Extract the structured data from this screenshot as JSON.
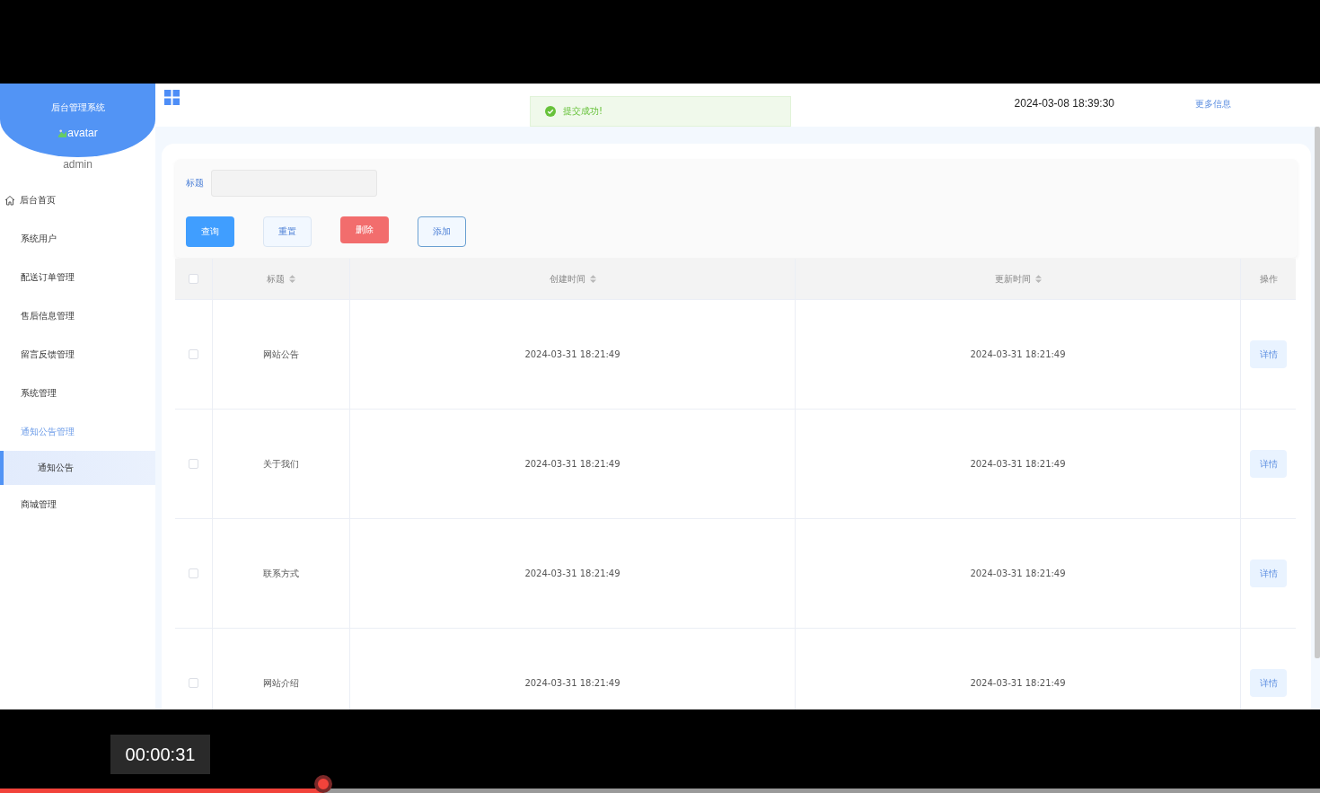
{
  "header": {
    "title": "后台管理系统",
    "avatar_alt": "avatar",
    "user": "admin",
    "datetime": "2024-03-08 18:39:30",
    "more_link": "更多信息"
  },
  "toast": {
    "kind": "success",
    "message": "提交成功!"
  },
  "sidebar": {
    "items": [
      {
        "kind": "home",
        "label": "后台首页",
        "selected": false,
        "expanded": false
      },
      {
        "kind": "group",
        "label": "系统用户",
        "selected": false,
        "expanded": false
      },
      {
        "kind": "group",
        "label": "配送订单管理",
        "selected": false,
        "expanded": false
      },
      {
        "kind": "group",
        "label": "售后信息管理",
        "selected": false,
        "expanded": false
      },
      {
        "kind": "group",
        "label": "留言反馈管理",
        "selected": false,
        "expanded": false
      },
      {
        "kind": "group",
        "label": "系统管理",
        "selected": false,
        "expanded": false
      },
      {
        "kind": "group",
        "label": "通知公告管理",
        "selected": false,
        "expanded": true,
        "children": [
          {
            "label": "通知公告",
            "selected": true
          }
        ]
      },
      {
        "kind": "group",
        "label": "商城管理",
        "selected": false,
        "expanded": false
      }
    ]
  },
  "search": {
    "label": "标题"
  },
  "buttons": [
    {
      "kind": "primary",
      "label": "查询"
    },
    {
      "kind": "plain",
      "label": "重置"
    },
    {
      "kind": "danger",
      "label": "删除"
    },
    {
      "kind": "hover",
      "label": "添加"
    }
  ],
  "table": {
    "header_checked": false,
    "columns": [
      {
        "label": "标题",
        "sortable": true
      },
      {
        "label": "创建时间",
        "sortable": true
      },
      {
        "label": "更新时间",
        "sortable": true
      },
      {
        "label": "操作",
        "sortable": false
      }
    ],
    "rows": [
      {
        "checked": false,
        "title": "网站公告",
        "created": "2024-03-31 18:21:49",
        "updated": "2024-03-31 18:21:49",
        "action": "详情"
      },
      {
        "checked": false,
        "title": "关于我们",
        "created": "2024-03-31 18:21:49",
        "updated": "2024-03-31 18:21:49",
        "action": "详情"
      },
      {
        "checked": false,
        "title": "联系方式",
        "created": "2024-03-31 18:21:49",
        "updated": "2024-03-31 18:21:49",
        "action": "详情"
      },
      {
        "checked": false,
        "title": "网站介绍",
        "created": "2024-03-31 18:21:49",
        "updated": "2024-03-31 18:21:49",
        "action": "详情"
      }
    ]
  },
  "video": {
    "time": "00:00:31",
    "level": 0.245
  }
}
